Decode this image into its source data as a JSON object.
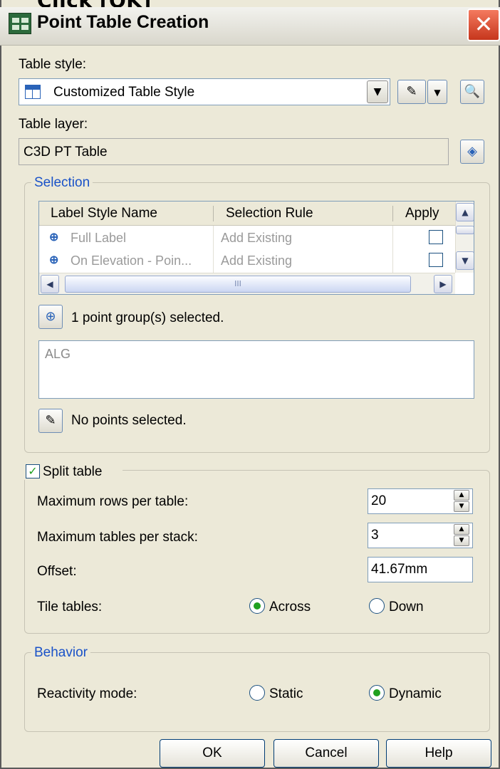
{
  "caption": "Click [OK]",
  "window": {
    "title": "Point Table Creation",
    "close_glyph": "✕"
  },
  "table_style": {
    "label": "Table style:",
    "value": "Customized Table Style"
  },
  "table_layer": {
    "label": "Table layer:",
    "value": "C3D PT Table"
  },
  "selection": {
    "group_title": "Selection",
    "columns": [
      "Label Style Name",
      "Selection Rule",
      "Apply"
    ],
    "rows": [
      {
        "name": "Full Label",
        "rule": "Add Existing",
        "apply": false
      },
      {
        "name": "On Elevation - Poin...",
        "rule": "Add Existing",
        "apply": false
      }
    ],
    "scroll_grip": "III",
    "groups_status": "1 point group(s) selected.",
    "groups_list": [
      "ALG"
    ],
    "points_status": "No points selected."
  },
  "split_table": {
    "label": "Split table",
    "checked": true,
    "max_rows_label": "Maximum rows per table:",
    "max_rows_value": "20",
    "max_tables_label": "Maximum tables per stack:",
    "max_tables_value": "3",
    "offset_label": "Offset:",
    "offset_value": "41.67mm",
    "tile_label": "Tile tables:",
    "tile_options": [
      "Across",
      "Down"
    ],
    "tile_selected": "Across"
  },
  "behavior": {
    "group_title": "Behavior",
    "reactivity_label": "Reactivity mode:",
    "options": [
      "Static",
      "Dynamic"
    ],
    "selected": "Dynamic"
  },
  "buttons": {
    "ok": "OK",
    "cancel": "Cancel",
    "help": "Help"
  }
}
